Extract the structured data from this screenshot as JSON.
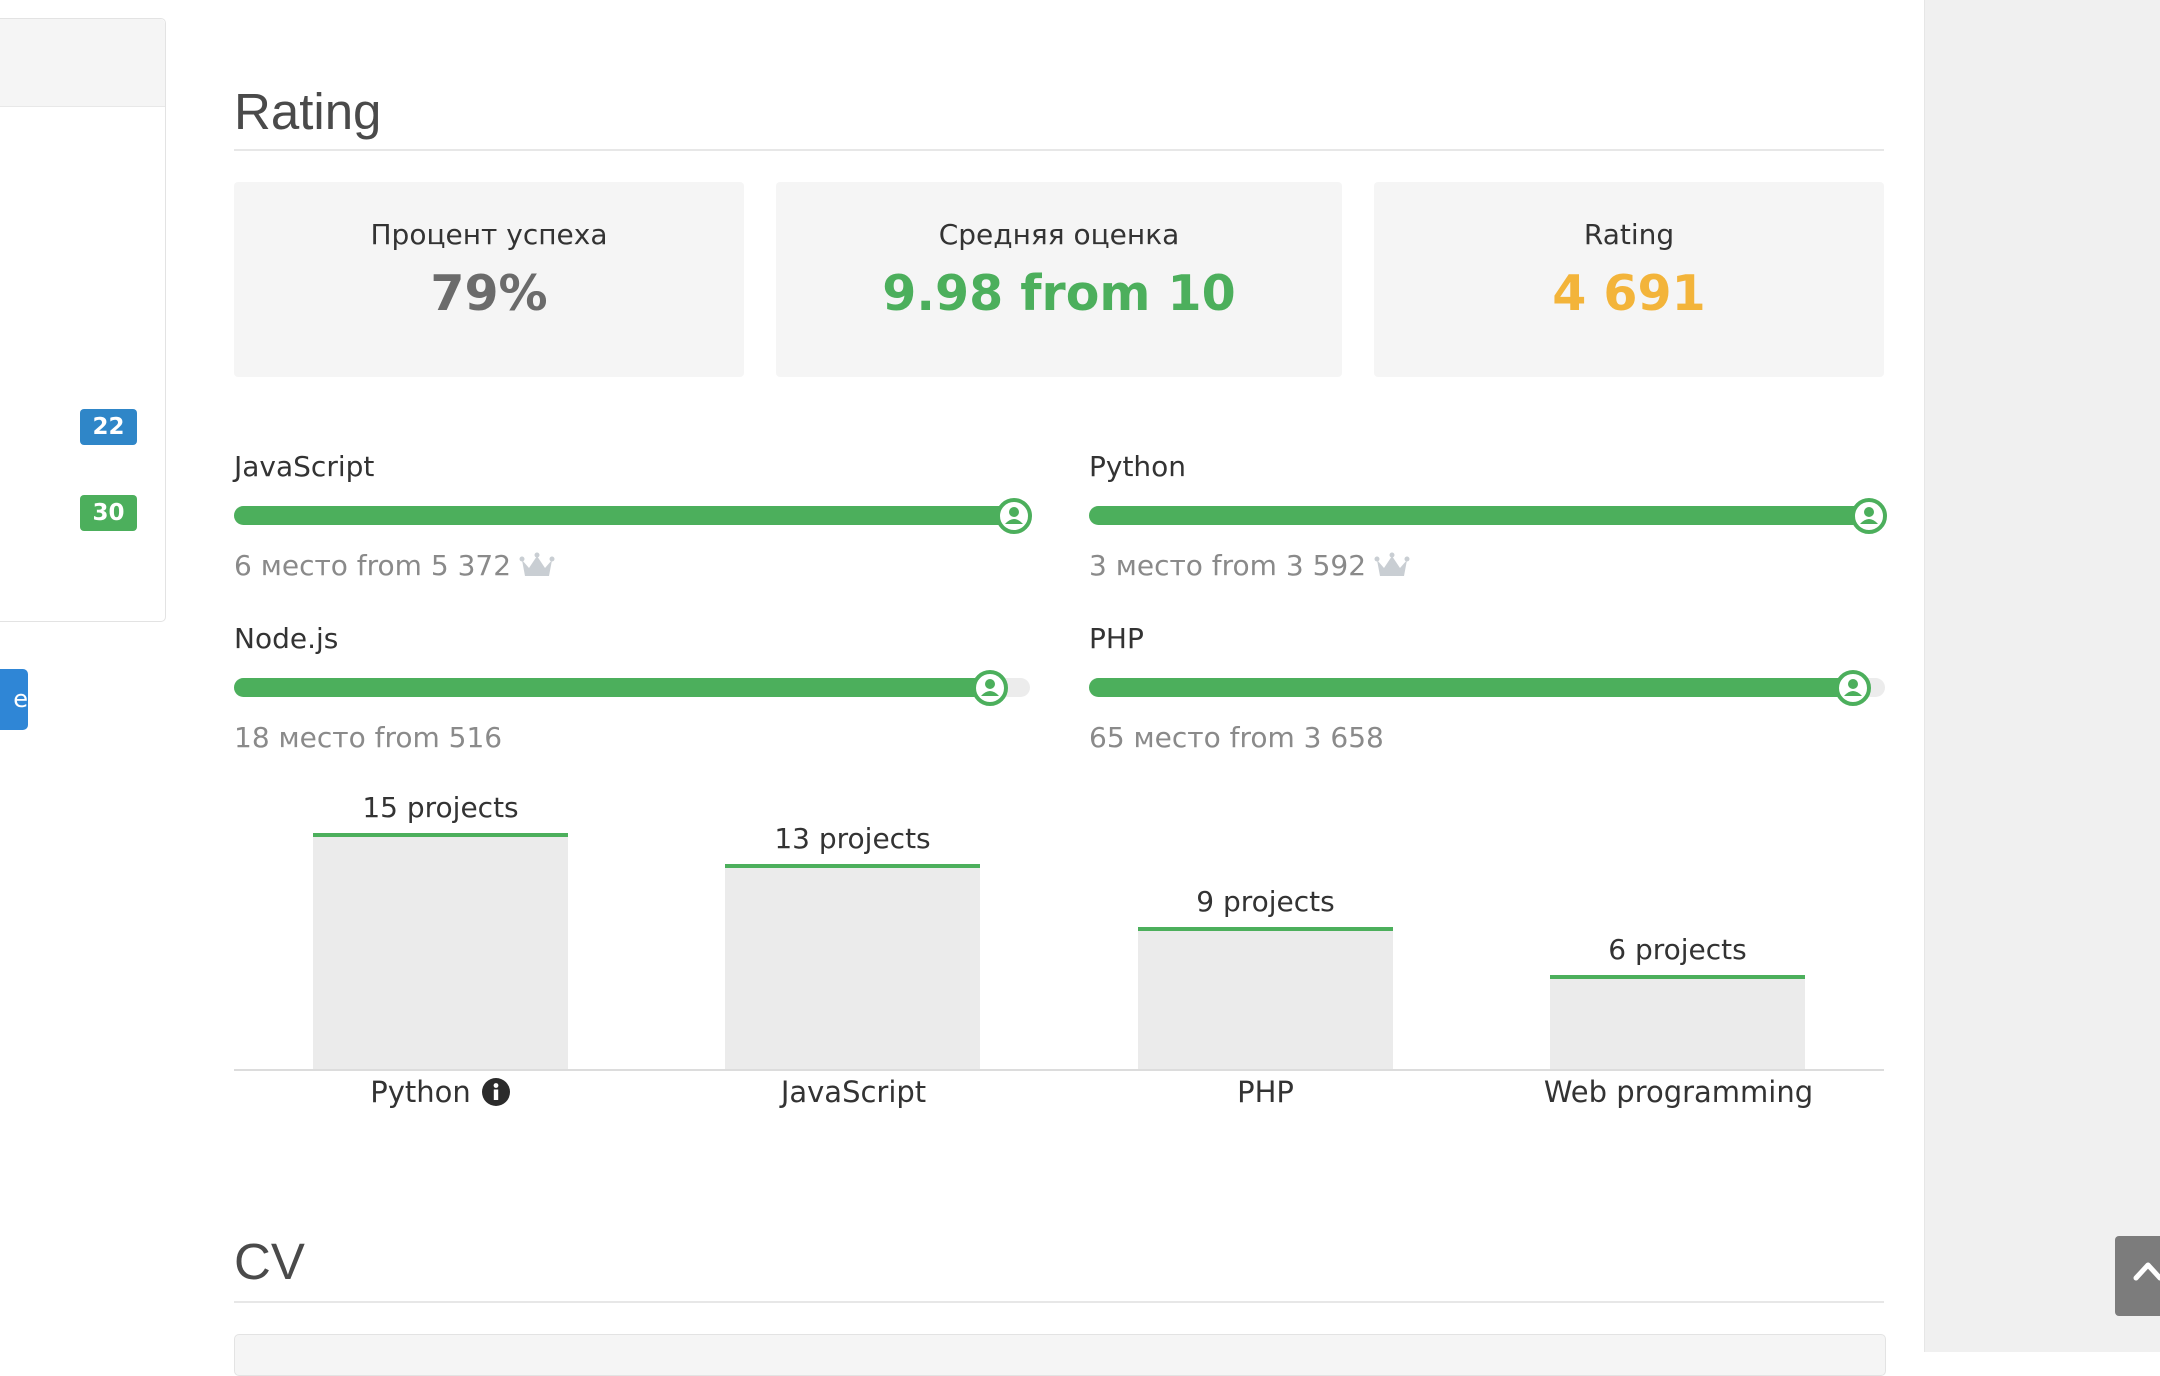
{
  "sidebar": {
    "badges": [
      {
        "count": "22",
        "color": "#2f86c8"
      },
      {
        "count": "30",
        "color": "#4caf5c"
      }
    ],
    "button_fragment": "e"
  },
  "rating_section": {
    "title": "Rating",
    "stats": [
      {
        "label": "Процент успеха",
        "value": "79%",
        "color": "#6b6b6b"
      },
      {
        "label": "Средняя оценка",
        "value": "9.98 from 10",
        "color": "#4caf5c"
      },
      {
        "label": "Rating",
        "value": "4 691",
        "color": "#f3b43a"
      }
    ],
    "rankings": [
      {
        "name": "JavaScript",
        "place_text": "6 место from 5 372",
        "progress_percent": 98,
        "crown": true
      },
      {
        "name": "Python",
        "place_text": "3 место from 3 592",
        "progress_percent": 98,
        "crown": true
      },
      {
        "name": "Node.js",
        "place_text": "18 место from 516",
        "progress_percent": 95,
        "crown": false
      },
      {
        "name": "PHP",
        "place_text": "65 место from 3 658",
        "progress_percent": 96,
        "crown": false
      }
    ],
    "accent_color": "#4caf5c"
  },
  "chart_data": {
    "type": "bar",
    "categories": [
      "Python",
      "JavaScript",
      "PHP",
      "Web programming"
    ],
    "values": [
      15,
      13,
      9,
      6
    ],
    "data_labels": [
      "15 projects",
      "13 projects",
      "9 projects",
      "6 projects"
    ],
    "info_icon_on": "Python",
    "title": "",
    "xlabel": "",
    "ylabel": "",
    "ylim": [
      0,
      15
    ],
    "grid": false
  },
  "cv_section": {
    "title": "CV"
  }
}
